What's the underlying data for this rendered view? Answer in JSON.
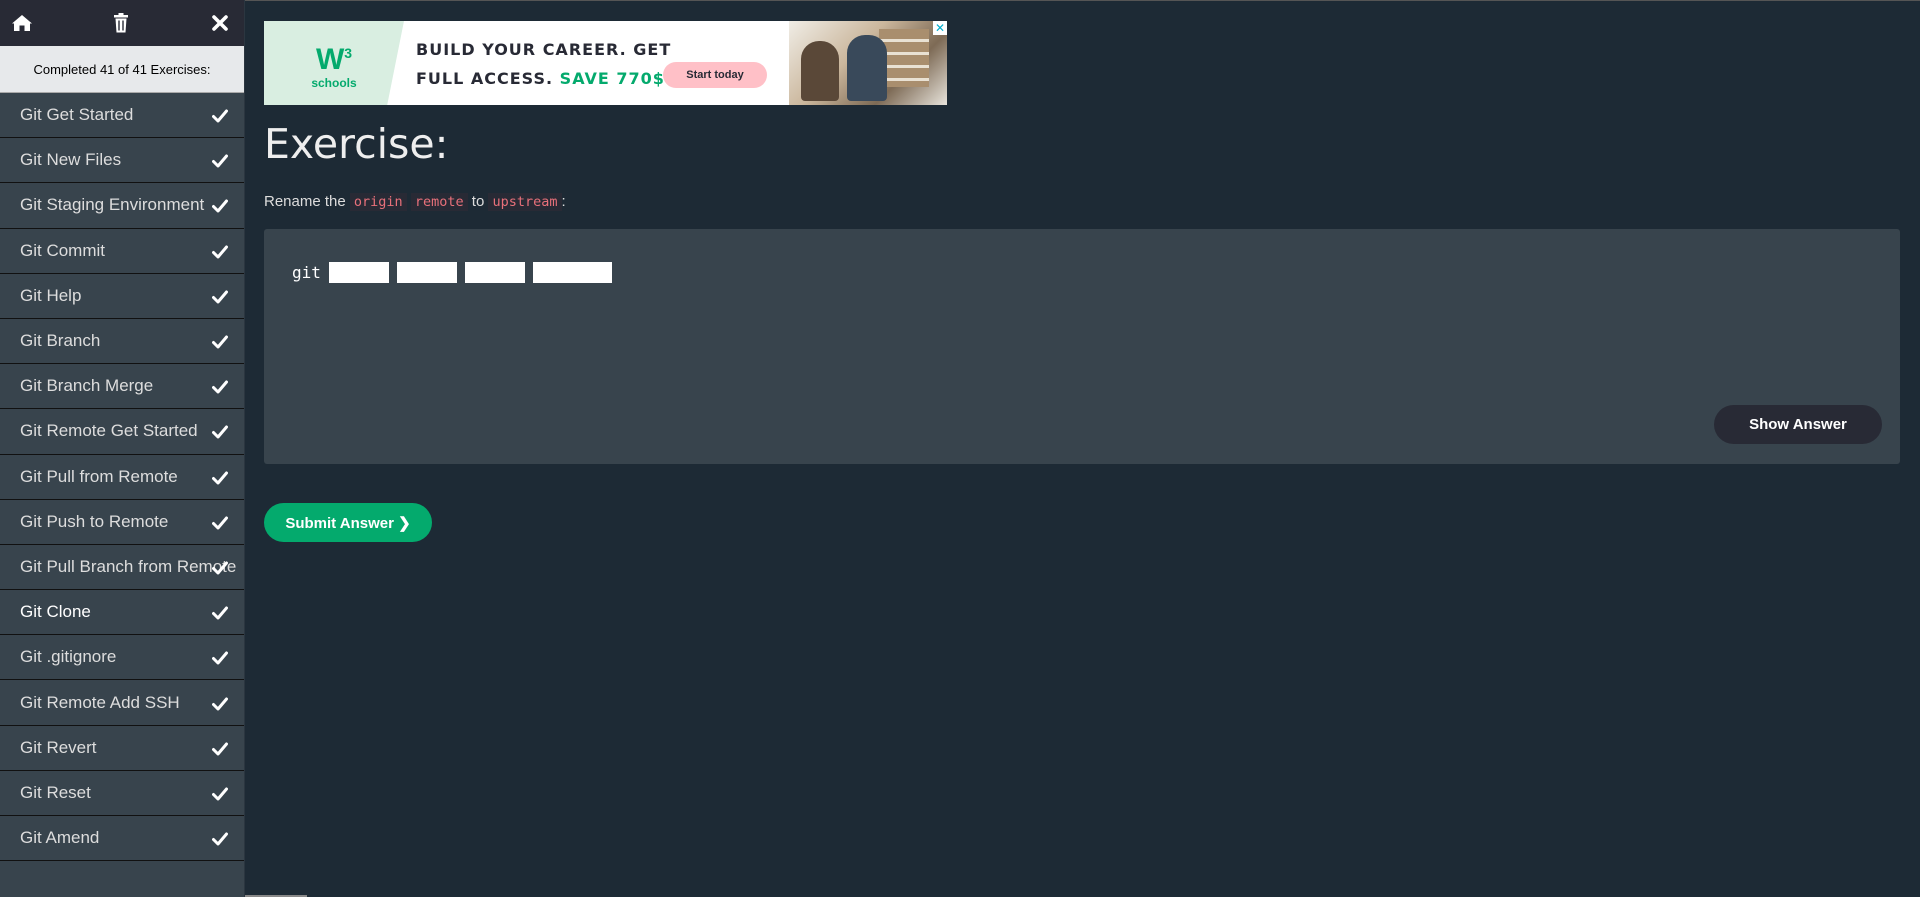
{
  "sidebar": {
    "progress_text": "Completed 41 of 41 Exercises:",
    "items": [
      {
        "label": "Git Get Started",
        "active": false
      },
      {
        "label": "Git New Files",
        "active": false
      },
      {
        "label": "Git Staging Environment",
        "active": false
      },
      {
        "label": "Git Commit",
        "active": false
      },
      {
        "label": "Git Help",
        "active": false
      },
      {
        "label": "Git Branch",
        "active": false
      },
      {
        "label": "Git Branch Merge",
        "active": false
      },
      {
        "label": "Git Remote Get Started",
        "active": false
      },
      {
        "label": "Git Pull from Remote",
        "active": false
      },
      {
        "label": "Git Push to Remote",
        "active": false
      },
      {
        "label": "Git Pull Branch from Remote",
        "active": false
      },
      {
        "label": "Git Clone",
        "active": true
      },
      {
        "label": "Git .gitignore",
        "active": false
      },
      {
        "label": "Git Remote Add SSH",
        "active": false
      },
      {
        "label": "Git Revert",
        "active": false
      },
      {
        "label": "Git Reset",
        "active": false
      },
      {
        "label": "Git Amend",
        "active": false
      }
    ]
  },
  "ad": {
    "logo_text": "W3",
    "logo_sup": "3",
    "logo_sub": "schools",
    "headline_line1": "BUILD YOUR CAREER. GET",
    "headline_line2_prefix": "FULL ACCESS.",
    "headline_line2_save": "SAVE 770$",
    "cta": "Start today",
    "close": "✕"
  },
  "exercise": {
    "title": "Exercise:",
    "instruction_prefix": "Rename the",
    "chip_origin": "origin",
    "chip_remote": "remote",
    "instruction_to": "to",
    "chip_upstream": "upstream",
    "instruction_suffix": ":",
    "code_prefix": "git",
    "blank_values": [
      "",
      "",
      "",
      ""
    ],
    "show_answer": "Show Answer",
    "submit": "Submit Answer ❯"
  },
  "colors": {
    "background": "#1d2a35",
    "sidebar": "#38444d",
    "accent_green": "#04aa6d",
    "chip_text": "#e8707a"
  }
}
